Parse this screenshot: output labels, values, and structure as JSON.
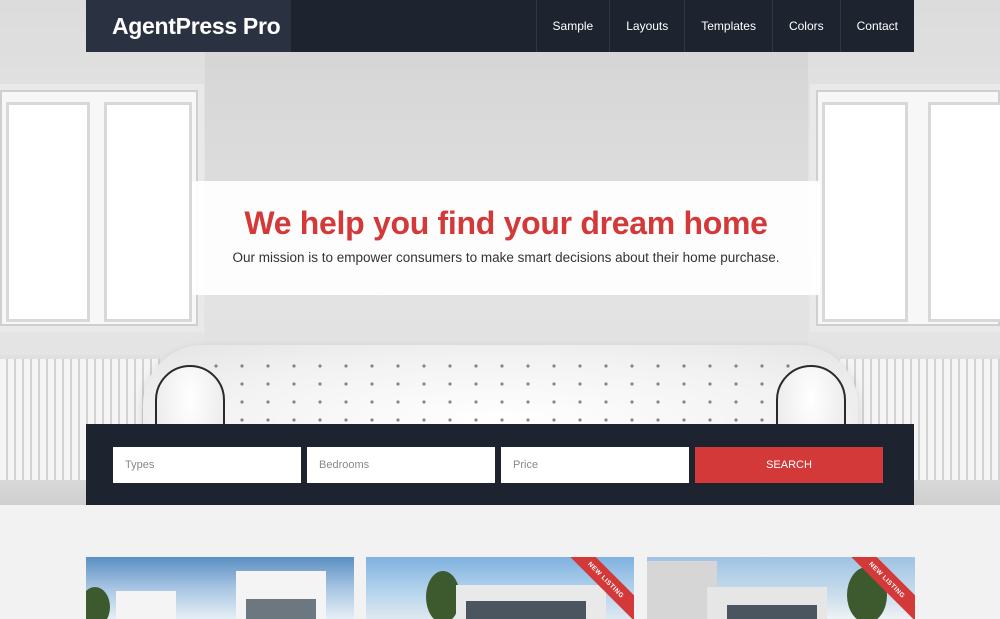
{
  "header": {
    "logo": "AgentPress Pro",
    "nav": [
      "Sample",
      "Layouts",
      "Templates",
      "Colors",
      "Contact"
    ]
  },
  "banner": {
    "title": "We help you find your dream home",
    "subtitle": "Our mission is to empower consumers to make smart decisions about their home purchase."
  },
  "search": {
    "types_placeholder": "Types",
    "bedrooms_placeholder": "Bedrooms",
    "price_placeholder": "Price",
    "button_label": "SEARCH"
  },
  "listings": [
    {
      "badge": ""
    },
    {
      "badge": "NEW LISTING"
    },
    {
      "badge": "NEW LISTING"
    }
  ],
  "colors": {
    "accent": "#d43939",
    "header_bg": "#1d2430"
  }
}
